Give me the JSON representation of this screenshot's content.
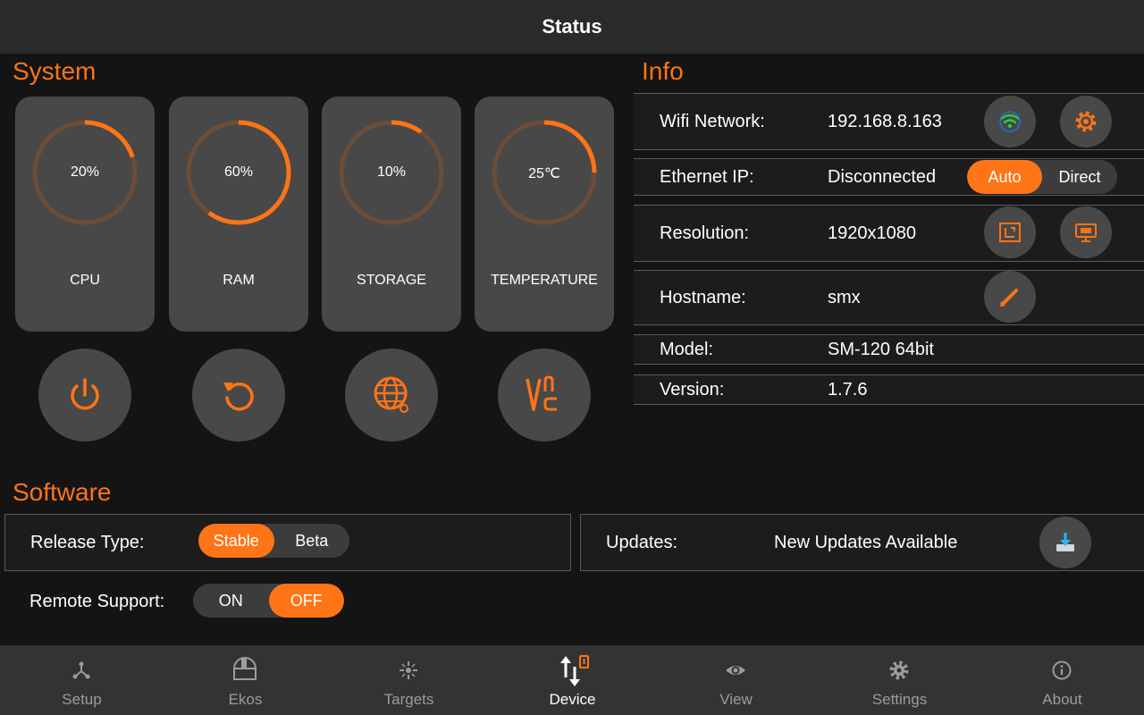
{
  "header": {
    "title": "Status"
  },
  "colors": {
    "accent": "#ff7417",
    "card": "#484848",
    "ring_track": "#6b4d3a"
  },
  "system": {
    "title": "System",
    "gauges": [
      {
        "label": "CPU",
        "value_text": "20%",
        "fraction": 0.2
      },
      {
        "label": "RAM",
        "value_text": "60%",
        "fraction": 0.6
      },
      {
        "label": "STORAGE",
        "value_text": "10%",
        "fraction": 0.1
      },
      {
        "label": "TEMPERATURE",
        "value_text": "25℃",
        "fraction": 0.25
      }
    ],
    "buttons": [
      {
        "icon": "power-icon"
      },
      {
        "icon": "restart-icon"
      },
      {
        "icon": "globe-icon"
      },
      {
        "icon": "vnc-icon"
      }
    ]
  },
  "info": {
    "title": "Info",
    "wifi": {
      "label": "Wifi Network:",
      "value": "192.168.8.163"
    },
    "ethernet": {
      "label": "Ethernet IP:",
      "value": "Disconnected",
      "options": [
        "Auto",
        "Direct"
      ],
      "selected": "Auto"
    },
    "resolution": {
      "label": "Resolution:",
      "value": "1920x1080"
    },
    "hostname": {
      "label": "Hostname:",
      "value": "smx"
    },
    "model": {
      "label": "Model:",
      "value": "SM-120 64bit"
    },
    "version": {
      "label": "Version:",
      "value": "1.7.6"
    }
  },
  "software": {
    "title": "Software",
    "release": {
      "label": "Release Type:",
      "options": [
        "Stable",
        "Beta"
      ],
      "selected": "Stable"
    },
    "updates": {
      "label": "Updates:",
      "value": "New Updates Available"
    },
    "remote": {
      "label": "Remote Support:",
      "options": [
        "ON",
        "OFF"
      ],
      "selected": "OFF"
    }
  },
  "nav": {
    "items": [
      {
        "label": "Setup",
        "icon": "setup-icon"
      },
      {
        "label": "Ekos",
        "icon": "ekos-icon"
      },
      {
        "label": "Targets",
        "icon": "targets-icon"
      },
      {
        "label": "Device",
        "icon": "device-icon",
        "active": true
      },
      {
        "label": "View",
        "icon": "eye-icon"
      },
      {
        "label": "Settings",
        "icon": "gear-icon"
      },
      {
        "label": "About",
        "icon": "info-icon"
      }
    ]
  }
}
